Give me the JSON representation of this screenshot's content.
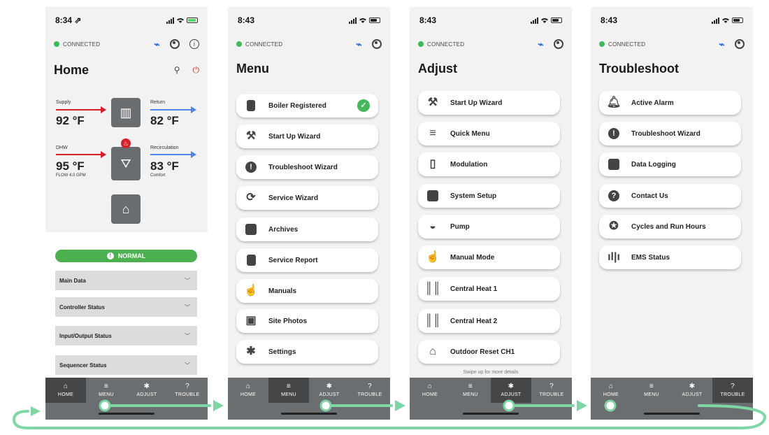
{
  "nav": [
    "HOME",
    "MENU",
    "ADJUST",
    "TROUBLE"
  ],
  "connection": "CONNECTED",
  "home": {
    "time": "8:34 ⇗",
    "title": "Home",
    "supply_label": "Supply",
    "supply_val": "92 °F",
    "return_label": "Return",
    "return_val": "82 °F",
    "dhw_label": "DHW",
    "dhw_val": "95 °F",
    "dhw_flow": "FLOW 4.0 GPM",
    "recirc_label": "Recirculation",
    "recirc_val": "83 °F",
    "recirc_sub": "Comfort",
    "status": "NORMAL",
    "sections": [
      "Main Data",
      "Controller Status",
      "Input/Output Status",
      "Sequencer Status"
    ]
  },
  "menu": {
    "time": "8:43",
    "title": "Menu",
    "items": [
      "Boiler Registered",
      "Start Up Wizard",
      "Troubleshoot Wizard",
      "Service Wizard",
      "Archives",
      "Service Report",
      "Manuals",
      "Site Photos",
      "Settings"
    ]
  },
  "adjust": {
    "time": "8:43",
    "title": "Adjust",
    "items": [
      "Start Up Wizard",
      "Quick Menu",
      "Modulation",
      "System Setup",
      "Pump",
      "Manual Mode",
      "Central Heat 1",
      "Central Heat 2",
      "Outdoor Reset CH1"
    ],
    "hint": "Swipe up for more details"
  },
  "trouble": {
    "time": "8:43",
    "title": "Troubleshoot",
    "items": [
      "Active Alarm",
      "Troubleshoot Wizard",
      "Data Logging",
      "Contact Us",
      "Cycles and Run Hours",
      "EMS Status"
    ]
  },
  "colors": {
    "flow": "#7ed6a5",
    "connected": "#3dbb5b",
    "normal": "#4caf50"
  }
}
